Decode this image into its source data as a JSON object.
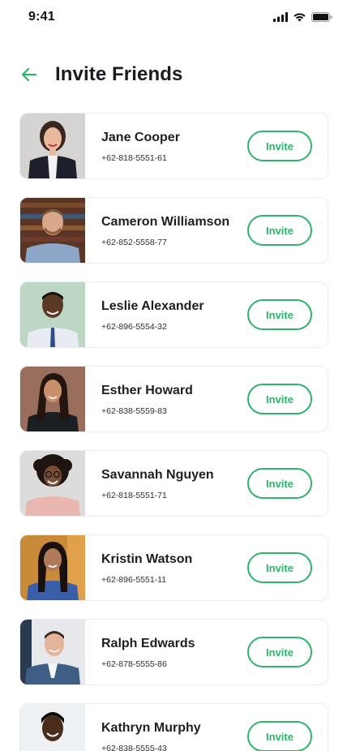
{
  "status_bar": {
    "time": "9:41",
    "icons": [
      "signal-icon",
      "wifi-icon",
      "battery-icon"
    ]
  },
  "header": {
    "back_icon": "arrow-left-icon",
    "title": "Invite Friends"
  },
  "colors": {
    "accent": "#2fb36a",
    "title": "#1a1c22",
    "card_border": "#ececec"
  },
  "contacts": [
    {
      "name": "Jane Cooper",
      "phone": "+62-818-5551-61",
      "action": "Invite"
    },
    {
      "name": "Cameron Williamson",
      "phone": "+62-852-5558-77",
      "action": "Invite"
    },
    {
      "name": "Leslie Alexander",
      "phone": "+62-896-5554-32",
      "action": "Invite"
    },
    {
      "name": "Esther Howard",
      "phone": "+62-838-5559-83",
      "action": "Invite"
    },
    {
      "name": "Savannah Nguyen",
      "phone": "+62-818-5551-71",
      "action": "Invite"
    },
    {
      "name": "Kristin Watson",
      "phone": "+62-896-5551-11",
      "action": "Invite"
    },
    {
      "name": "Ralph Edwards",
      "phone": "+62-878-5555-86",
      "action": "Invite"
    },
    {
      "name": "Kathryn Murphy",
      "phone": "+62-838-5555-43",
      "action": "Invite"
    }
  ]
}
